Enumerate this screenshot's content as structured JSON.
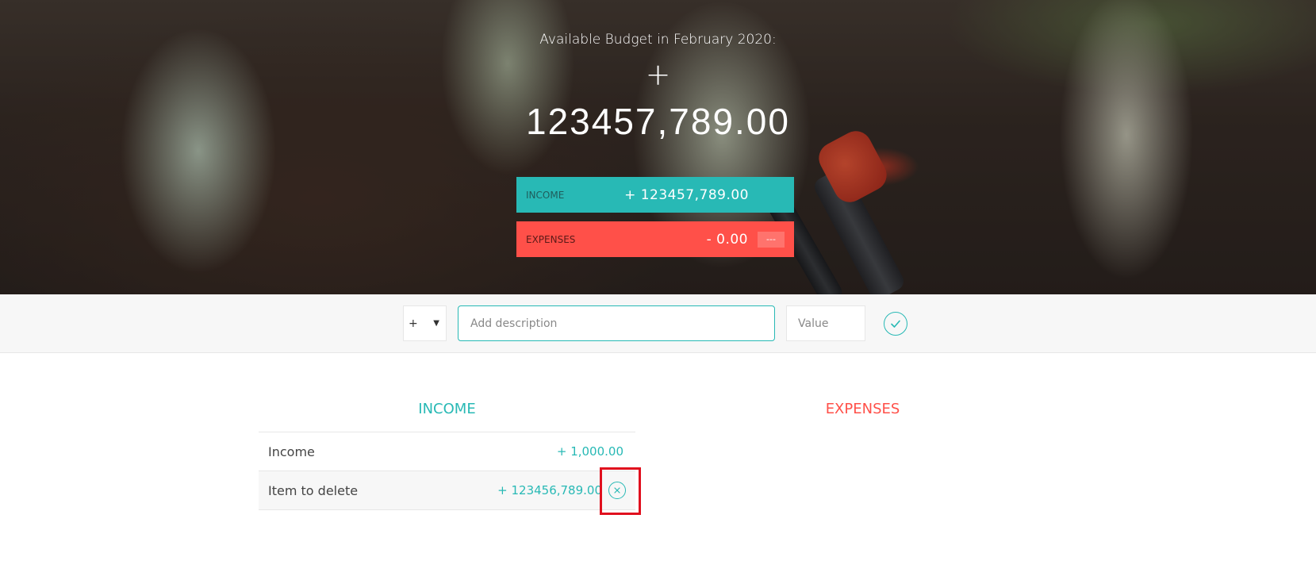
{
  "budget": {
    "title": "Available Budget in February 2020:",
    "sign": "+",
    "value": "123457,789.00"
  },
  "summary": {
    "income": {
      "label": "INCOME",
      "value": "+ 123457,789.00"
    },
    "expenses": {
      "label": "EXPENSES",
      "value": "- 0.00",
      "percentage": "---"
    }
  },
  "add_bar": {
    "type_value": "+",
    "type_arrow": "▼",
    "description_placeholder": "Add description",
    "value_placeholder": "Value"
  },
  "income_list": {
    "title": "INCOME",
    "items": [
      {
        "description": "Income",
        "value": "+ 1,000.00"
      },
      {
        "description": "Item to delete",
        "value": "+ 123456,789.00"
      }
    ]
  },
  "expenses_list": {
    "title": "EXPENSES",
    "items": []
  },
  "colors": {
    "income": "#28b9b5",
    "expenses": "#ff5049",
    "highlight": "#e0101e"
  },
  "icons": {
    "add": "checkmark-circle-icon",
    "delete": "close-circle-icon"
  }
}
